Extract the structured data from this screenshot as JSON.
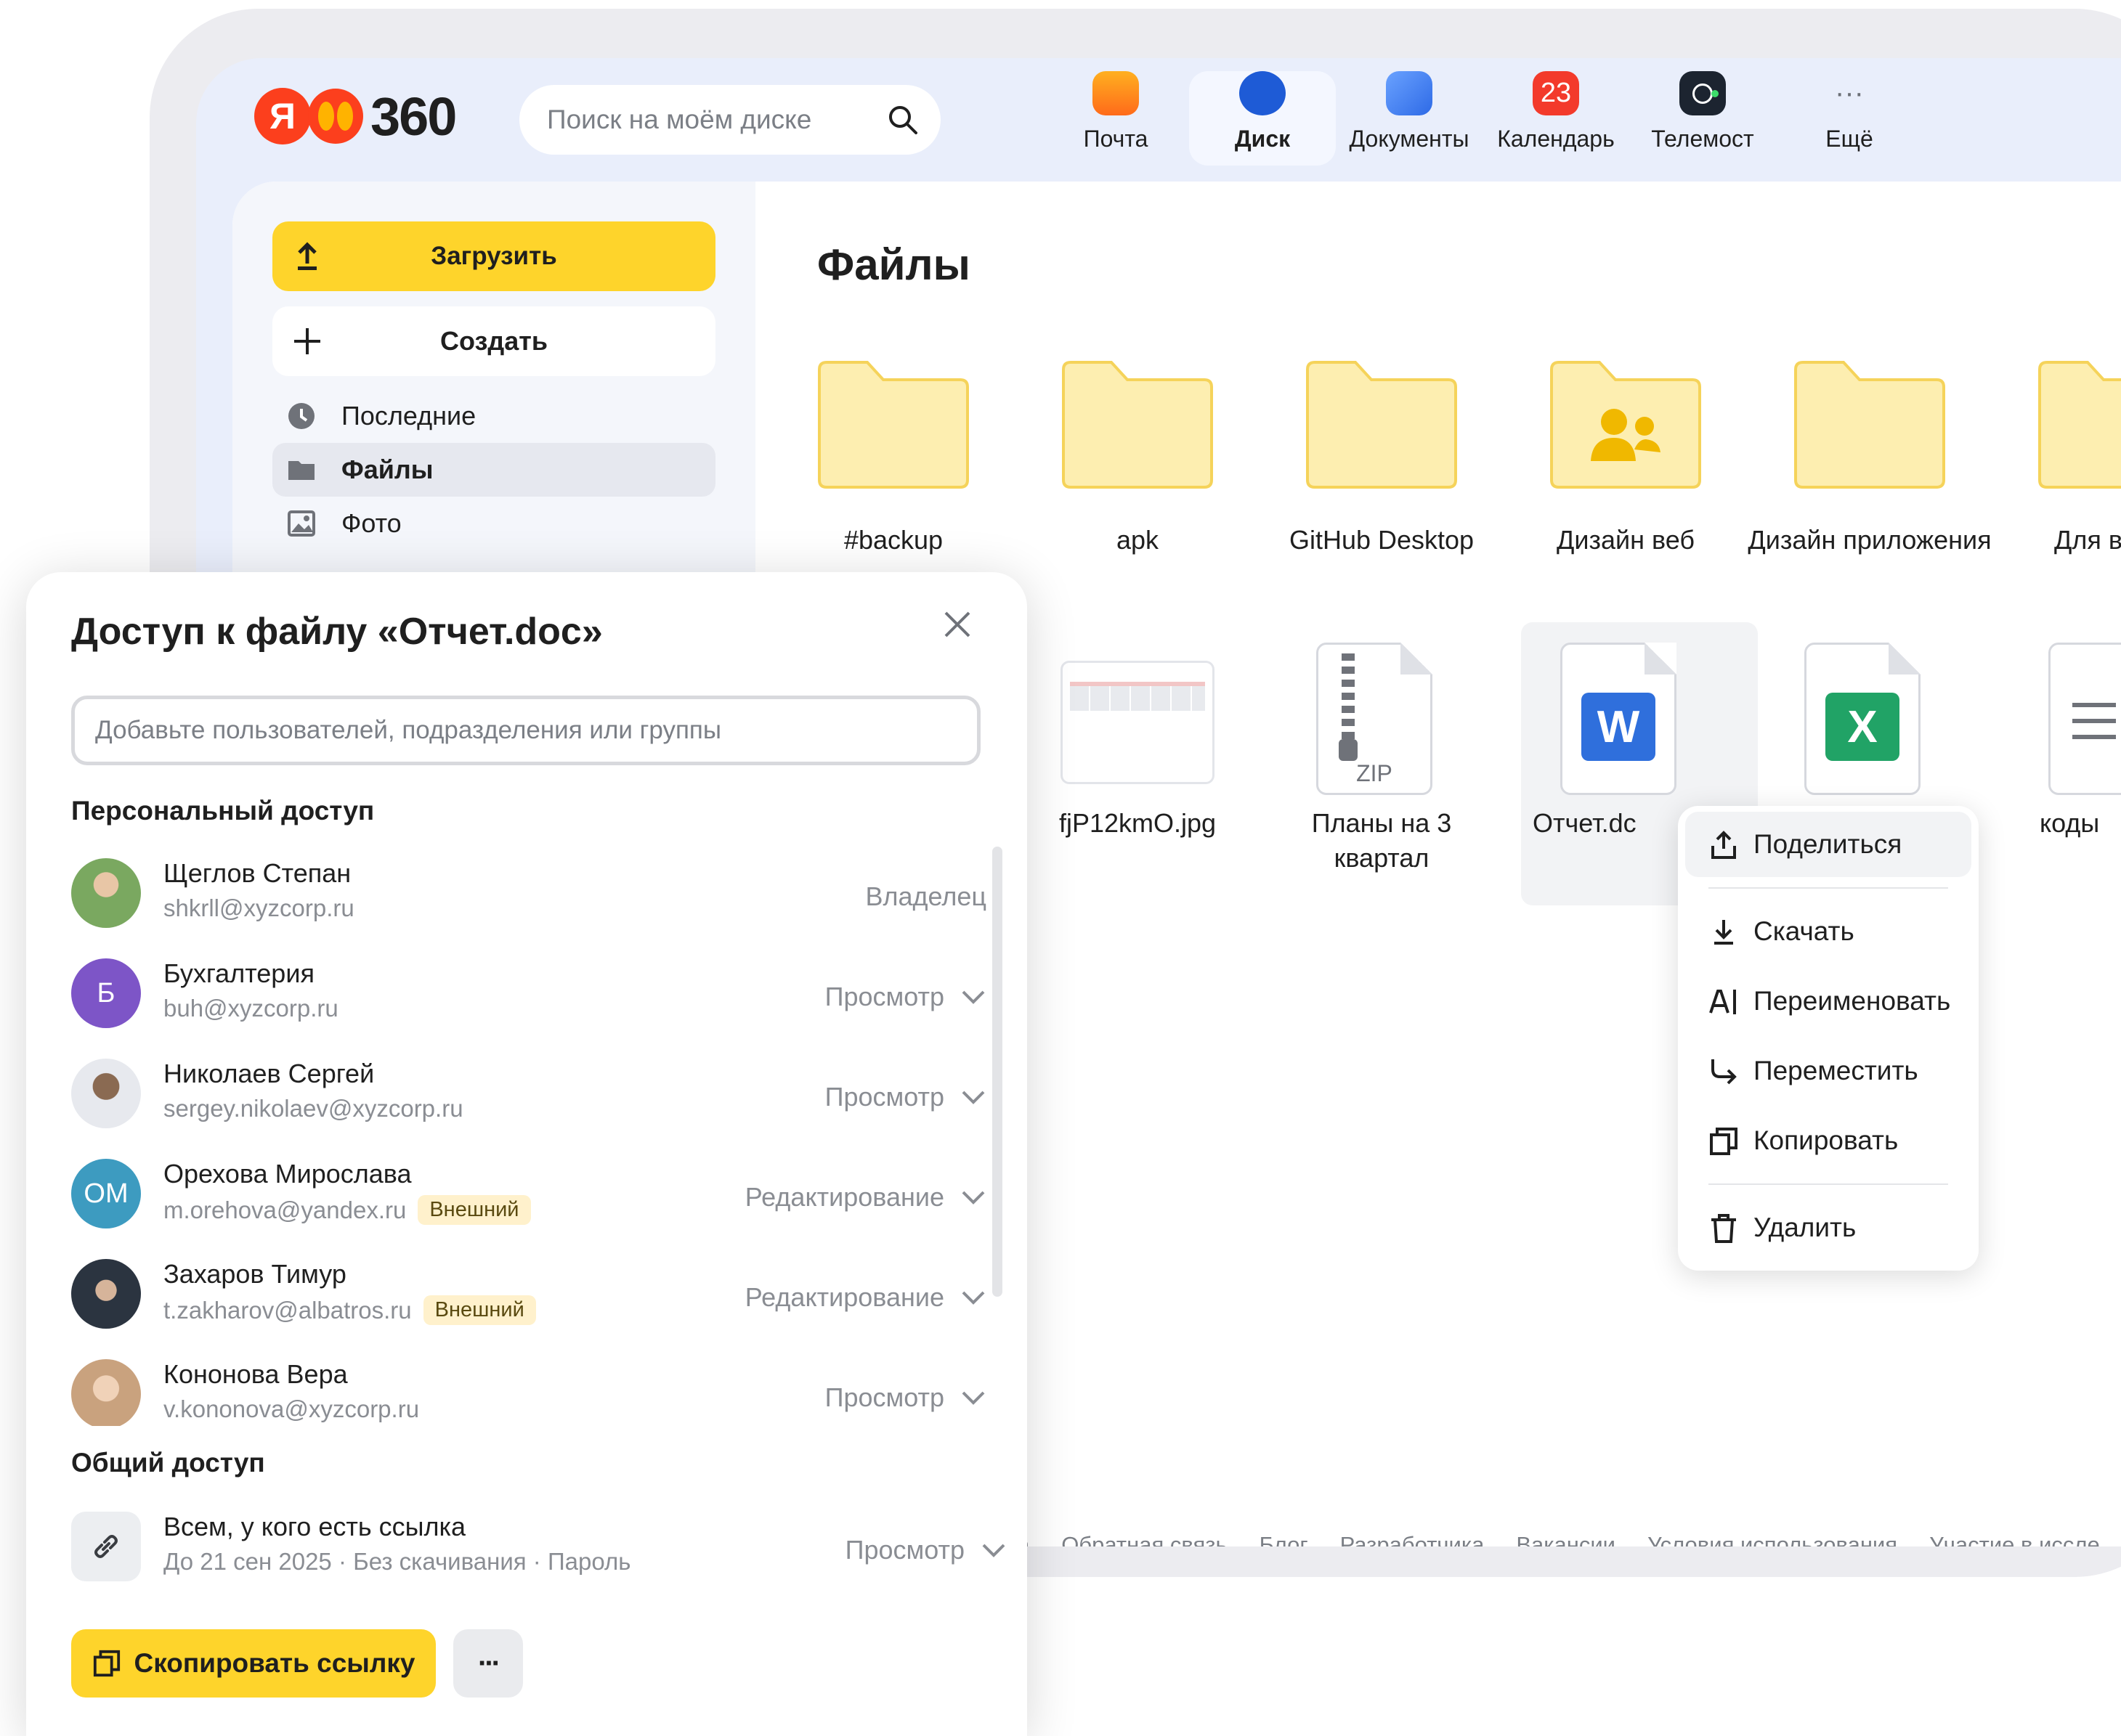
{
  "header": {
    "brand_number": "360",
    "brand_letter": "Я",
    "search_placeholder": "Поиск на моём диске",
    "apps": [
      {
        "label": "Почта",
        "icon": "mail-icon",
        "color": "#ff9c1a"
      },
      {
        "label": "Диск",
        "icon": "disk-icon",
        "color": "#1e5bd6",
        "active": true
      },
      {
        "label": "Документы",
        "icon": "documents-icon",
        "color": "#3b82f6"
      },
      {
        "label": "Календарь",
        "icon": "calendar-icon",
        "color": "#f33a2b",
        "badge": "23"
      },
      {
        "label": "Телемост",
        "icon": "telemost-icon",
        "color": "#1c2430"
      },
      {
        "label": "Ещё",
        "icon": "more-dots-icon",
        "glyph": "···"
      }
    ]
  },
  "sidebar": {
    "upload_label": "Загрузить",
    "create_label": "Создать",
    "items": [
      {
        "label": "Последние",
        "icon": "clock-icon"
      },
      {
        "label": "Файлы",
        "icon": "folder-icon",
        "active": true
      },
      {
        "label": "Фото",
        "icon": "photo-icon"
      }
    ]
  },
  "main": {
    "title": "Файлы",
    "folders": [
      "#backup",
      "apk",
      "GitHub Desktop",
      "Дизайн веб",
      "Дизайн приложения",
      "Для в"
    ],
    "files": [
      {
        "label": "fjP12kmO.jpg",
        "kind": "image"
      },
      {
        "label": "Планы на 3 квартал",
        "kind": "zip",
        "ext": "ZIP"
      },
      {
        "label": "Отчет.dc",
        "kind": "word",
        "letter": "W",
        "color": "#2f6fdc"
      },
      {
        "label": "",
        "kind": "excel",
        "letter": "X",
        "color": "#21a366"
      },
      {
        "label": "коды",
        "kind": "text"
      }
    ],
    "footer_links": [
      "а",
      "Обратная связь",
      "Блог",
      "Разработчика",
      "Вакансии",
      "Условия использования",
      "Участие в иссле"
    ]
  },
  "context_menu": {
    "items": [
      "Поделиться",
      "Скачать",
      "Переименовать",
      "Переместить",
      "Копировать",
      "Удалить"
    ]
  },
  "dialog": {
    "title": "Доступ к файлу «Отчет.doc»",
    "input_placeholder": "Добавьте пользователей, подразделения или группы",
    "personal_heading": "Персональный доступ",
    "people": [
      {
        "name": "Щеглов Степан",
        "email": "shkrll@xyzcorp.ru",
        "role": "Владелец",
        "avatar": "photo",
        "color": "#7aa860"
      },
      {
        "name": "Бухгалтерия",
        "email": "buh@xyzcorp.ru",
        "role": "Просмотр",
        "avatar": "Б",
        "color": "#7d55c7"
      },
      {
        "name": "Николаев Сергей",
        "email": "sergey.nikolaev@xyzcorp.ru",
        "role": "Просмотр",
        "avatar": "photo",
        "color": "#8a6a52"
      },
      {
        "name": "Орехова Мирослава",
        "email": "m.orehova@yandex.ru",
        "badge": "Внешний",
        "role": "Редактирование",
        "avatar": "ОМ",
        "color": "#3d9bc0"
      },
      {
        "name": "Захаров Тимур",
        "email": "t.zakharov@albatros.ru",
        "badge": "Внешний",
        "role": "Редактирование",
        "avatar": "photo",
        "color": "#2b3440"
      },
      {
        "name": "Кононова Вера",
        "email": "v.kononova@xyzcorp.ru",
        "role": "Просмотр",
        "avatar": "photo",
        "color": "#c9a27e"
      }
    ],
    "general_heading": "Общий доступ",
    "link": {
      "title": "Всем, у кого есть ссылка",
      "details": "До 21 сен 2025 · Без скачивания · Пароль",
      "role": "Просмотр"
    },
    "copy_link_label": "Скопировать ссылку",
    "more_label": "···"
  }
}
